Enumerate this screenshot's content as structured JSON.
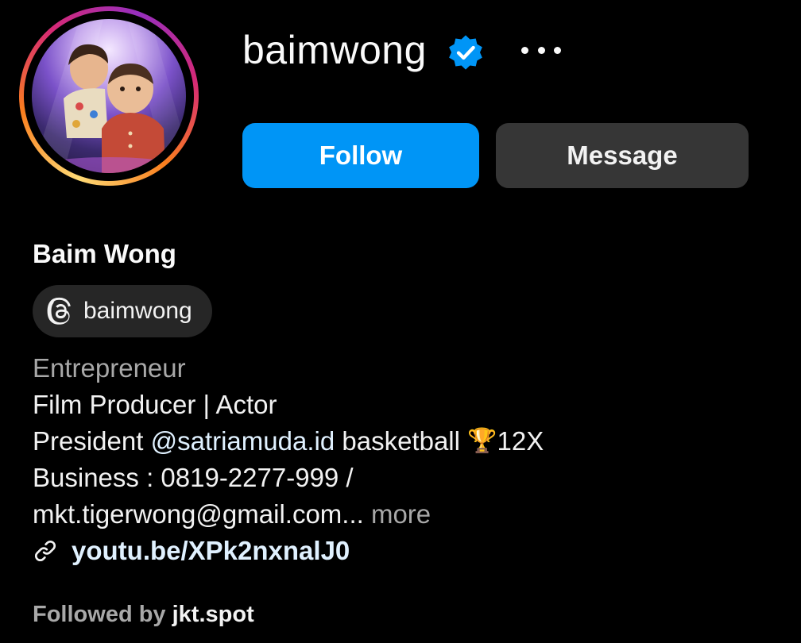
{
  "profile": {
    "username": "baimwong",
    "full_name": "Baim Wong",
    "verified_icon": "verified-badge-icon",
    "more_icon": "more-options-icon"
  },
  "actions": {
    "follow_label": "Follow",
    "message_label": "Message"
  },
  "threads": {
    "icon": "threads-icon",
    "handle": "baimwong"
  },
  "bio": {
    "category": "Entrepreneur",
    "line1": "Film Producer | Actor",
    "line2_prefix": "President ",
    "line2_mention": "@satriamuda.id",
    "line2_middle": " basketball ",
    "line2_emoji": "🏆",
    "line2_suffix": "12X",
    "line3": "Business : 0819-2277-999 /",
    "line4": "mkt.tigerwong@gmail.com...",
    "more_label": "more"
  },
  "link": {
    "icon": "link-icon",
    "text": "youtu.be/XPk2nxnalJ0"
  },
  "followed_by": {
    "prefix": "Followed by ",
    "account": "jkt.spot"
  },
  "colors": {
    "background": "#000000",
    "follow_button": "#0095f6",
    "message_button": "#363636",
    "link": "#e0f1ff",
    "secondary_text": "#a8a8a8",
    "verified": "#0095f6"
  }
}
